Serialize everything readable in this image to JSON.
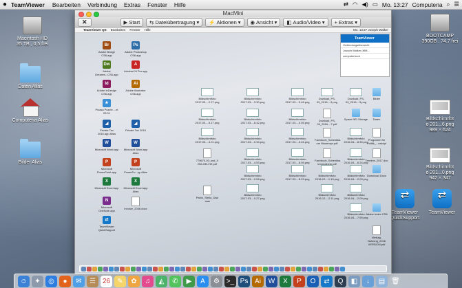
{
  "menubar": {
    "apple": "",
    "app_name": "TeamViewer",
    "items": [
      "Bearbeiten",
      "Verbindung",
      "Extras",
      "Fenster",
      "Hilfe"
    ],
    "clock": "Mo. 13:27",
    "user": "Computeria"
  },
  "desktop_icons": [
    {
      "label": "Macintosh HD\n35 TB , 0,5 frei",
      "kind": "drive"
    },
    {
      "label": "Daten Alias",
      "kind": "folder"
    },
    {
      "label": "Computeria Alias",
      "kind": "house"
    },
    {
      "label": "Bilder Alias",
      "kind": "folder"
    },
    {
      "label": "BOOTCAMP\n390GB , 74,7 frei",
      "kind": "drive"
    },
    {
      "label": "Bildschirmfot\no 201...6.png\n989 × 624",
      "kind": "shot"
    },
    {
      "label": "Bildschirmfot\no 201...0.png\n942 × 347",
      "kind": "shot"
    },
    {
      "label": "TeamViewer\nQuickSupport",
      "kind": "tv"
    },
    {
      "label": "TeamViewer",
      "kind": "tv"
    }
  ],
  "window": {
    "title": "MacMini",
    "toolbar": {
      "close": "✕",
      "start": "Start",
      "file_transfer": "Dateiübertragung",
      "actions": "Aktionen",
      "view": "Ansicht",
      "audio_video": "Audio/Video",
      "extras": "Extras"
    }
  },
  "remote": {
    "menubar": [
      "TeamViewer QS",
      "Bearbeiten",
      "Fenster",
      "Hilfe"
    ],
    "menubar_right": "Mo. 13:27  Joseph Walker",
    "panel": {
      "title": "TeamViewer",
      "rows": [
        "Verbindungsübersicht",
        "Joseph Walker (MM...",
        "computeria.ch"
      ]
    },
    "icons": [
      {
        "label": "Adobe Bridge CS6.app",
        "color": "#a04b12",
        "kind": "app",
        "glyph": "Br"
      },
      {
        "label": "Adobe Photoshop CS6.app",
        "color": "#2c6ea8",
        "kind": "app",
        "glyph": "Ps"
      },
      {
        "label": "Adobe Dreamw...CS6.app",
        "color": "#4f7a1f",
        "kind": "app",
        "glyph": "Dw"
      },
      {
        "label": "Acrobat XI Pro.app",
        "color": "#c92222",
        "kind": "app",
        "glyph": "A"
      },
      {
        "label": "Adobe InDesign CS6.app",
        "color": "#8b1b5e",
        "kind": "app",
        "glyph": "Id"
      },
      {
        "label": "Adobe Illustrator CS6.app",
        "color": "#b36a00",
        "kind": "app",
        "glyph": "Ai"
      },
      {
        "label": "Picasa Puzzle....nt 03.01",
        "color": "#3a8fd6",
        "kind": "app",
        "glyph": "★"
      },
      {
        "label": "Private Tax 2016.app Alias",
        "color": "#1d5fa8",
        "kind": "app",
        "glyph": "◢"
      },
      {
        "label": "Private Tax 2016",
        "color": "#1d5fa8",
        "kind": "app",
        "glyph": "◢"
      },
      {
        "label": "Microsoft Word.app",
        "color": "#1f4e9b",
        "kind": "app",
        "glyph": "W"
      },
      {
        "label": "Microsoft Word.app Alias",
        "color": "#1f4e9b",
        "kind": "app",
        "glyph": "W"
      },
      {
        "label": "Microsoft PowerPoint.app",
        "color": "#c3411c",
        "kind": "app",
        "glyph": "P"
      },
      {
        "label": "Microsoft PowerPo...pp Alias",
        "color": "#c3411c",
        "kind": "app",
        "glyph": "P"
      },
      {
        "label": "Microsoft Excel.app",
        "color": "#1d7a3c",
        "kind": "app",
        "glyph": "X"
      },
      {
        "label": "Microsoft Excel.app Alias",
        "color": "#1d7a3c",
        "kind": "app",
        "glyph": "X"
      },
      {
        "label": "Microsoft OneNote.app",
        "color": "#7b2d8e",
        "kind": "app",
        "glyph": "N"
      },
      {
        "label": "Invoice_2046.docx",
        "color": "#ffffff",
        "kind": "file",
        "glyph": ""
      },
      {
        "label": "TeamViewer QuickSupport",
        "color": "#1578c8",
        "kind": "app",
        "glyph": "⇄"
      },
      {
        "label": "Bildschirmfoto 2017-03-...2.27.png",
        "kind": "doc"
      },
      {
        "label": "Bildschirmfoto 2017-03-...3.30.png",
        "kind": "doc"
      },
      {
        "label": "Bildschirmfoto 2017-03-...3.46.png",
        "kind": "doc"
      },
      {
        "label": "Bildschirmfoto 2017-03-...5.17.png",
        "kind": "doc"
      },
      {
        "label": "Bildschirmfoto 2017-03-...4.01.png",
        "kind": "doc"
      },
      {
        "label": "770670-03_ssd_X 256-GB-VIE.pdf",
        "kind": "file"
      },
      {
        "label": "Pablo_Stella_Disk .wav",
        "kind": "file"
      },
      {
        "label": "Bildschirmfoto 2017-03-...8.42.png",
        "kind": "doc"
      },
      {
        "label": "Bildschirmfoto 2017-03-...0.34.png",
        "kind": "doc"
      },
      {
        "label": "Bildschirmfoto 2017-03-...4.53.png",
        "kind": "doc"
      },
      {
        "label": "Bildschirmfoto 2017-03-...2.06.png",
        "kind": "doc"
      },
      {
        "label": "Bildschirmfoto 2017-03-...0.27.png",
        "kind": "doc"
      },
      {
        "label": "Bildschirmfoto 2017-03-...0.05.png",
        "kind": "doc"
      },
      {
        "label": "Bildschirmfoto 2017-03-...3.46.png",
        "kind": "doc"
      },
      {
        "label": "Bildschirmfoto 2017-03-...8.09.png",
        "kind": "doc"
      },
      {
        "label": "Bildschirmfoto 2017-03-...8.29.png",
        "kind": "doc"
      },
      {
        "label": "Dowload_PS- 09_2016....3.png",
        "kind": "doc"
      },
      {
        "label": "Dowload_PS- 09_2016....7.pdf",
        "kind": "file"
      },
      {
        "label": "Fachbuch_Schenkka um Maoenspr.pdf",
        "kind": "file"
      },
      {
        "label": "Fachbuch_Schenkka tenmosbeip.pdf",
        "kind": "file"
      },
      {
        "label": "Bildschirmfoto 2016-12-...1.19.png",
        "kind": "doc"
      },
      {
        "label": "Bildschirmfoto 2016-12-...2.11.png",
        "kind": "doc"
      },
      {
        "label": "Dowload_PS- 09_2016....3.png",
        "kind": "doc"
      },
      {
        "label": "Space NEI Storage",
        "kind": "folder"
      },
      {
        "label": "Bilder",
        "kind": "folder"
      },
      {
        "label": "Daten",
        "kind": "folder"
      },
      {
        "label": "Bildschirmfoto 2016-04-...8.30.png",
        "kind": "doc"
      },
      {
        "label": "Bildschirmfoto 2016-04-...6.24.png",
        "kind": "doc"
      },
      {
        "label": "Bildschirmfoto 2016-04-...2.09.png",
        "kind": "doc"
      },
      {
        "label": "Bildschirmfoto 2016-04-...2.09.png",
        "kind": "doc"
      },
      {
        "label": "Bildschirmfoto 2016-04-...7.59.png",
        "kind": "doc"
      },
      {
        "label": "Programm für Politik_...uskript",
        "kind": "file"
      },
      {
        "label": "Termine_2017.doc",
        "kind": "file"
      },
      {
        "label": "Download Docs",
        "kind": "folder"
      },
      {
        "label": "Adobe Index CS6",
        "kind": "folder"
      },
      {
        "label": "Vertrag-Nutzung_2016 VERSION.pdf",
        "kind": "file"
      }
    ]
  },
  "dock_items": [
    "finder-icon",
    "launchpad-icon",
    "safari-icon",
    "firefox-icon",
    "mail-icon",
    "contacts-icon",
    "calendar-icon",
    "notes-icon",
    "photos-icon",
    "itunes-icon",
    "maps-icon",
    "messages-icon",
    "facetime-icon",
    "appstore-icon",
    "preferences-icon",
    "terminal-icon",
    "photoshop-icon",
    "illustrator-icon",
    "word-icon",
    "excel-icon",
    "powerpoint-icon",
    "outlook-icon",
    "teamviewer-icon",
    "quicktime-icon",
    "preview-icon",
    "downloads-stack-icon",
    "documents-stack-icon",
    "trash-icon"
  ]
}
